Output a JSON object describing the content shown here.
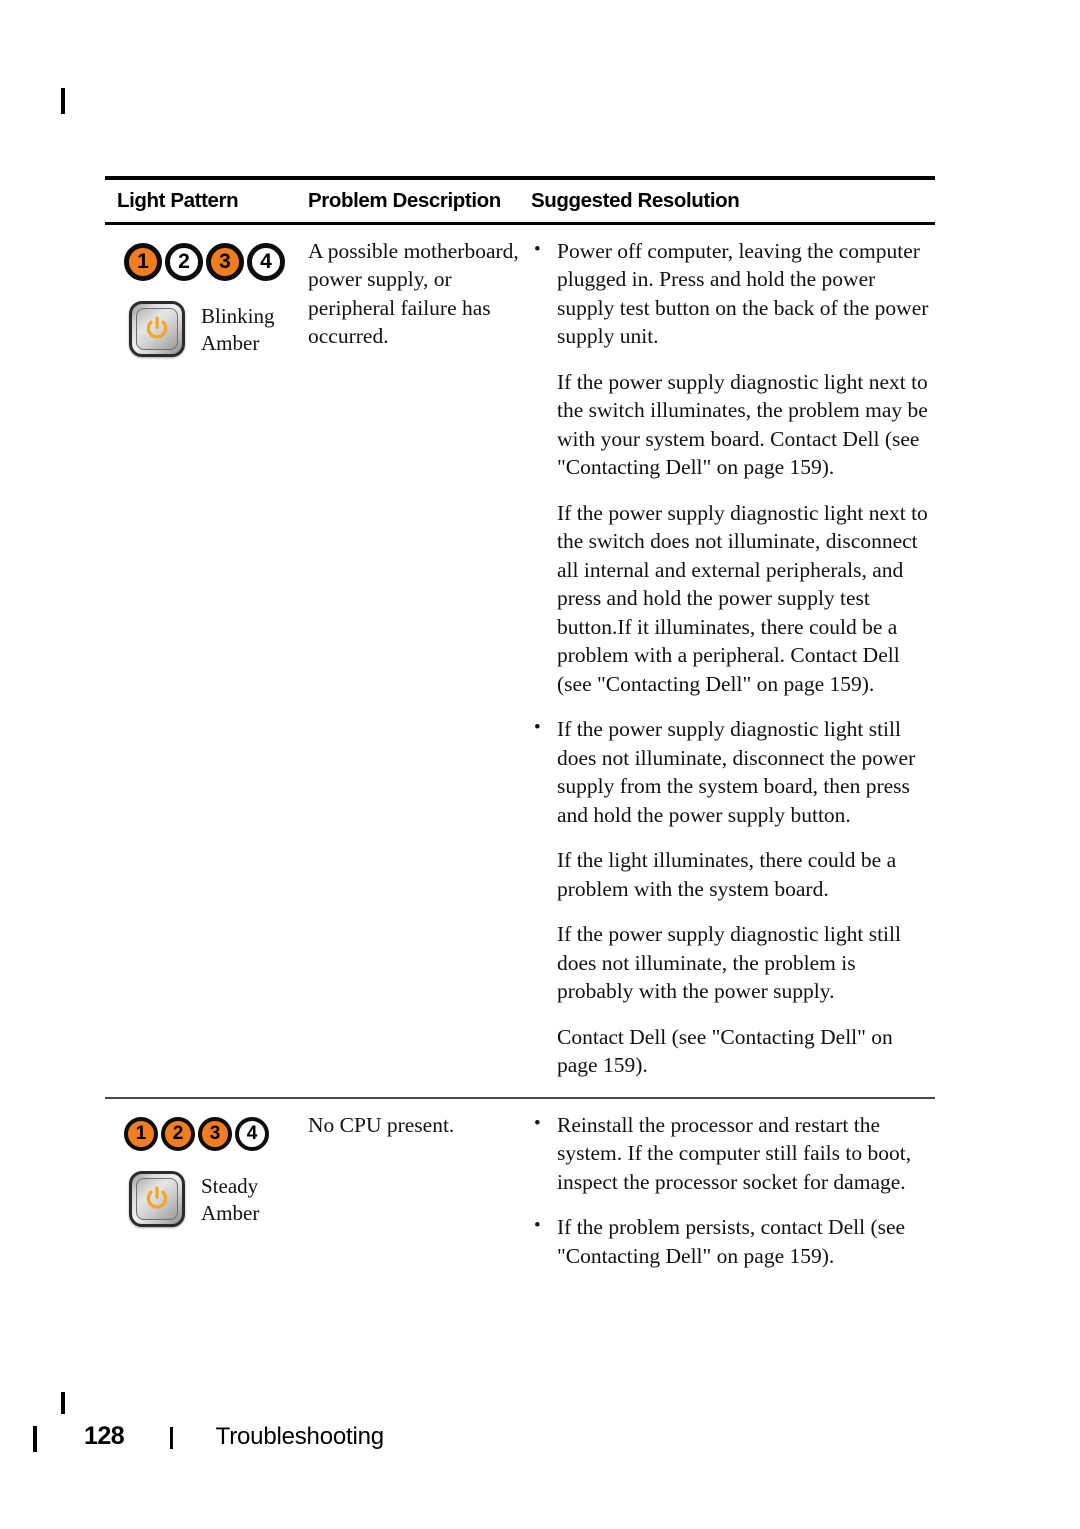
{
  "page": {
    "number": "128",
    "footer_separator": "|",
    "footer_section": "Troubleshooting"
  },
  "table": {
    "headers": {
      "light_pattern": "Light Pattern",
      "problem_description": "Problem Description",
      "suggested_resolution": "Suggested Resolution"
    },
    "colors": {
      "light_on": "#F07D20",
      "light_off": "#FFFFFF",
      "light_ring": "#0D0D0D",
      "power_glyph": "#F5A623",
      "rule": "#000000"
    },
    "rows": [
      {
        "light_pattern": {
          "lights": [
            {
              "label": "1",
              "state": "on"
            },
            {
              "label": "2",
              "state": "off"
            },
            {
              "label": "3",
              "state": "on"
            },
            {
              "label": "4",
              "state": "off"
            }
          ],
          "power_button_icon": "power-button-icon",
          "power_caption": "Blinking\nAmber"
        },
        "problem_description": "A possible motherboard, power supply, or peripheral failure has occurred.",
        "suggested_resolution": [
          {
            "bulleted": true,
            "text": "Power off computer, leaving the computer plugged in. Press and hold the power supply test button on the back of the power supply unit."
          },
          {
            "bulleted": false,
            "text": "If the power supply diagnostic light next to the switch illuminates, the problem may be with your system board. Contact Dell (see \"Contacting Dell\" on page 159)."
          },
          {
            "bulleted": false,
            "text": "If the power supply diagnostic light next to the switch does not illuminate, disconnect all internal and external peripherals, and press and hold the power supply test button.If it illuminates, there could be a problem with a peripheral. Contact Dell (see \"Contacting Dell\" on page 159)."
          },
          {
            "bulleted": true,
            "text": "If the power supply diagnostic light still does not illuminate, disconnect the power supply from the system board, then press and hold the power supply button."
          },
          {
            "bulleted": false,
            "text": "If the light illuminates, there could be a problem with the system board."
          },
          {
            "bulleted": false,
            "text": "If the power supply diagnostic light still does not illuminate, the problem is probably with the power supply."
          },
          {
            "bulleted": false,
            "text": "Contact Dell (see \"Contacting Dell\" on page 159)."
          }
        ]
      },
      {
        "light_pattern": {
          "lights": [
            {
              "label": "1",
              "state": "on"
            },
            {
              "label": "2",
              "state": "on"
            },
            {
              "label": "3",
              "state": "on"
            },
            {
              "label": "4",
              "state": "off"
            }
          ],
          "power_button_icon": "power-button-icon",
          "power_caption": "Steady\nAmber"
        },
        "problem_description": "No CPU present.",
        "suggested_resolution": [
          {
            "bulleted": true,
            "text": "Reinstall the processor and restart the system. If the computer still fails to boot, inspect the processor socket for damage."
          },
          {
            "bulleted": true,
            "text": "If the problem persists, contact Dell (see \"Contacting Dell\" on page 159)."
          }
        ]
      }
    ]
  }
}
